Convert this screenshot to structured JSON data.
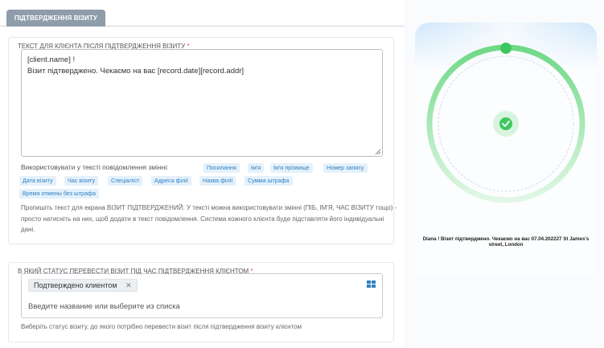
{
  "tab": {
    "label": "ПІДТВЕРДЖЕННЯ ВІЗИТУ"
  },
  "message_section": {
    "title": "ТЕКСТ ДЛЯ КЛІЄНТА ПІСЛЯ ПІДТВЕРДЖЕННЯ ВІЗИТУ",
    "required_mark": "*",
    "text_value": "[client.name] !\nВізит підтверджено. Чекаємо на вас [record.date][record.addr]",
    "vars_label": "Використовувати у тексті повідомлення змінні:",
    "variables": [
      "Посилання",
      "Ім'я",
      "Ім'я прізвище",
      "Номер запису",
      "Дата візиту",
      "Час візиту",
      "Спеціаліст",
      "Адреса філії",
      "Назва філії",
      "Сумма штрафа",
      "Время отмены без штрафа"
    ],
    "hint": "Пропишіть текст для екрана ВІЗИТ ПІДТВЕРДЖЕНИЙ. У тексті можна використовувати змінні (ПІБ, ІМ'Я, ЧАС ВІЗИТУ тощо) - просто натисніть на них, щоб додати в текст повідомлення. Система кожного клієнта буде підставляти його індивідуальні дані."
  },
  "status_section": {
    "title": "В ЯКИЙ СТАТУС ПЕРЕВЕСТИ ВІЗИТ ПІД ЧАС ПІДТВЕРДЖЕННЯ КЛІЄНТОМ",
    "required_mark": "*",
    "selected_tag": "Подтверждено клиентом",
    "tag_remove": "✕",
    "placeholder": "Введите название или выберите из списка",
    "hint": "Виберіть статус візиту, до якого потрібно перевести візит після підтвердження візиту клієнтом"
  },
  "preview": {
    "message": "Diana ! Візит підтверджено. Чекаємо на вас 07.04.202227 St James's street, London"
  },
  "colors": {
    "accent": "#3180c2",
    "tab_bg": "#8e9cab",
    "ring_green": "#3fc75f",
    "chip_bg": "#e4f1fb"
  }
}
